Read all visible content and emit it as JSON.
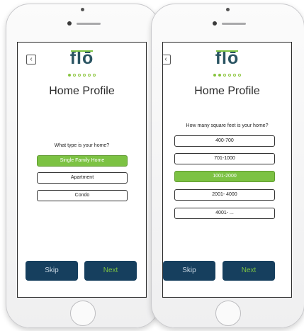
{
  "brand": {
    "logo_text": "flō",
    "accent": "#7cc243",
    "dark_blue": "#163f5e"
  },
  "screens": [
    {
      "back_icon": "chevron-left-icon",
      "progress": {
        "total": 6,
        "current": 1
      },
      "title": "Home Profile",
      "question": "What type is your home?",
      "options": [
        {
          "label": "Single Family Home",
          "selected": true
        },
        {
          "label": "Apartment",
          "selected": false
        },
        {
          "label": "Condo",
          "selected": false
        }
      ],
      "skip_label": "Skip",
      "next_label": "Next"
    },
    {
      "back_icon": "chevron-left-icon",
      "progress": {
        "total": 6,
        "current": 2
      },
      "title": "Home Profile",
      "question": "How many square feet is your home?",
      "options": [
        {
          "label": "400-700",
          "selected": false
        },
        {
          "label": "701-1000",
          "selected": false
        },
        {
          "label": "1001-2000",
          "selected": true
        },
        {
          "label": "2001- 4000",
          "selected": false
        },
        {
          "label": "4001- ...",
          "selected": false
        }
      ],
      "skip_label": "Skip",
      "next_label": "Next"
    }
  ]
}
